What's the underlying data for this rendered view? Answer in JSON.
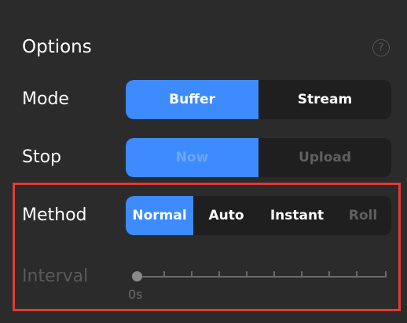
{
  "panel": {
    "title": "Options",
    "help_icon": "?"
  },
  "rows": {
    "mode": {
      "label": "Mode",
      "options": [
        "Buffer",
        "Stream"
      ],
      "selected": "Buffer"
    },
    "stop": {
      "label": "Stop",
      "options": [
        "Now",
        "Upload"
      ],
      "selected": "Now",
      "enabled": false
    },
    "method": {
      "label": "Method",
      "options": [
        "Normal",
        "Auto",
        "Instant",
        "Roll"
      ],
      "selected": "Normal"
    },
    "interval": {
      "label": "Interval",
      "value": "0s",
      "enabled": false
    }
  },
  "colors": {
    "accent": "#3d8bff",
    "background": "#2b2b2b",
    "segment_bg": "#1f1f1f",
    "highlight": "#e53935"
  }
}
